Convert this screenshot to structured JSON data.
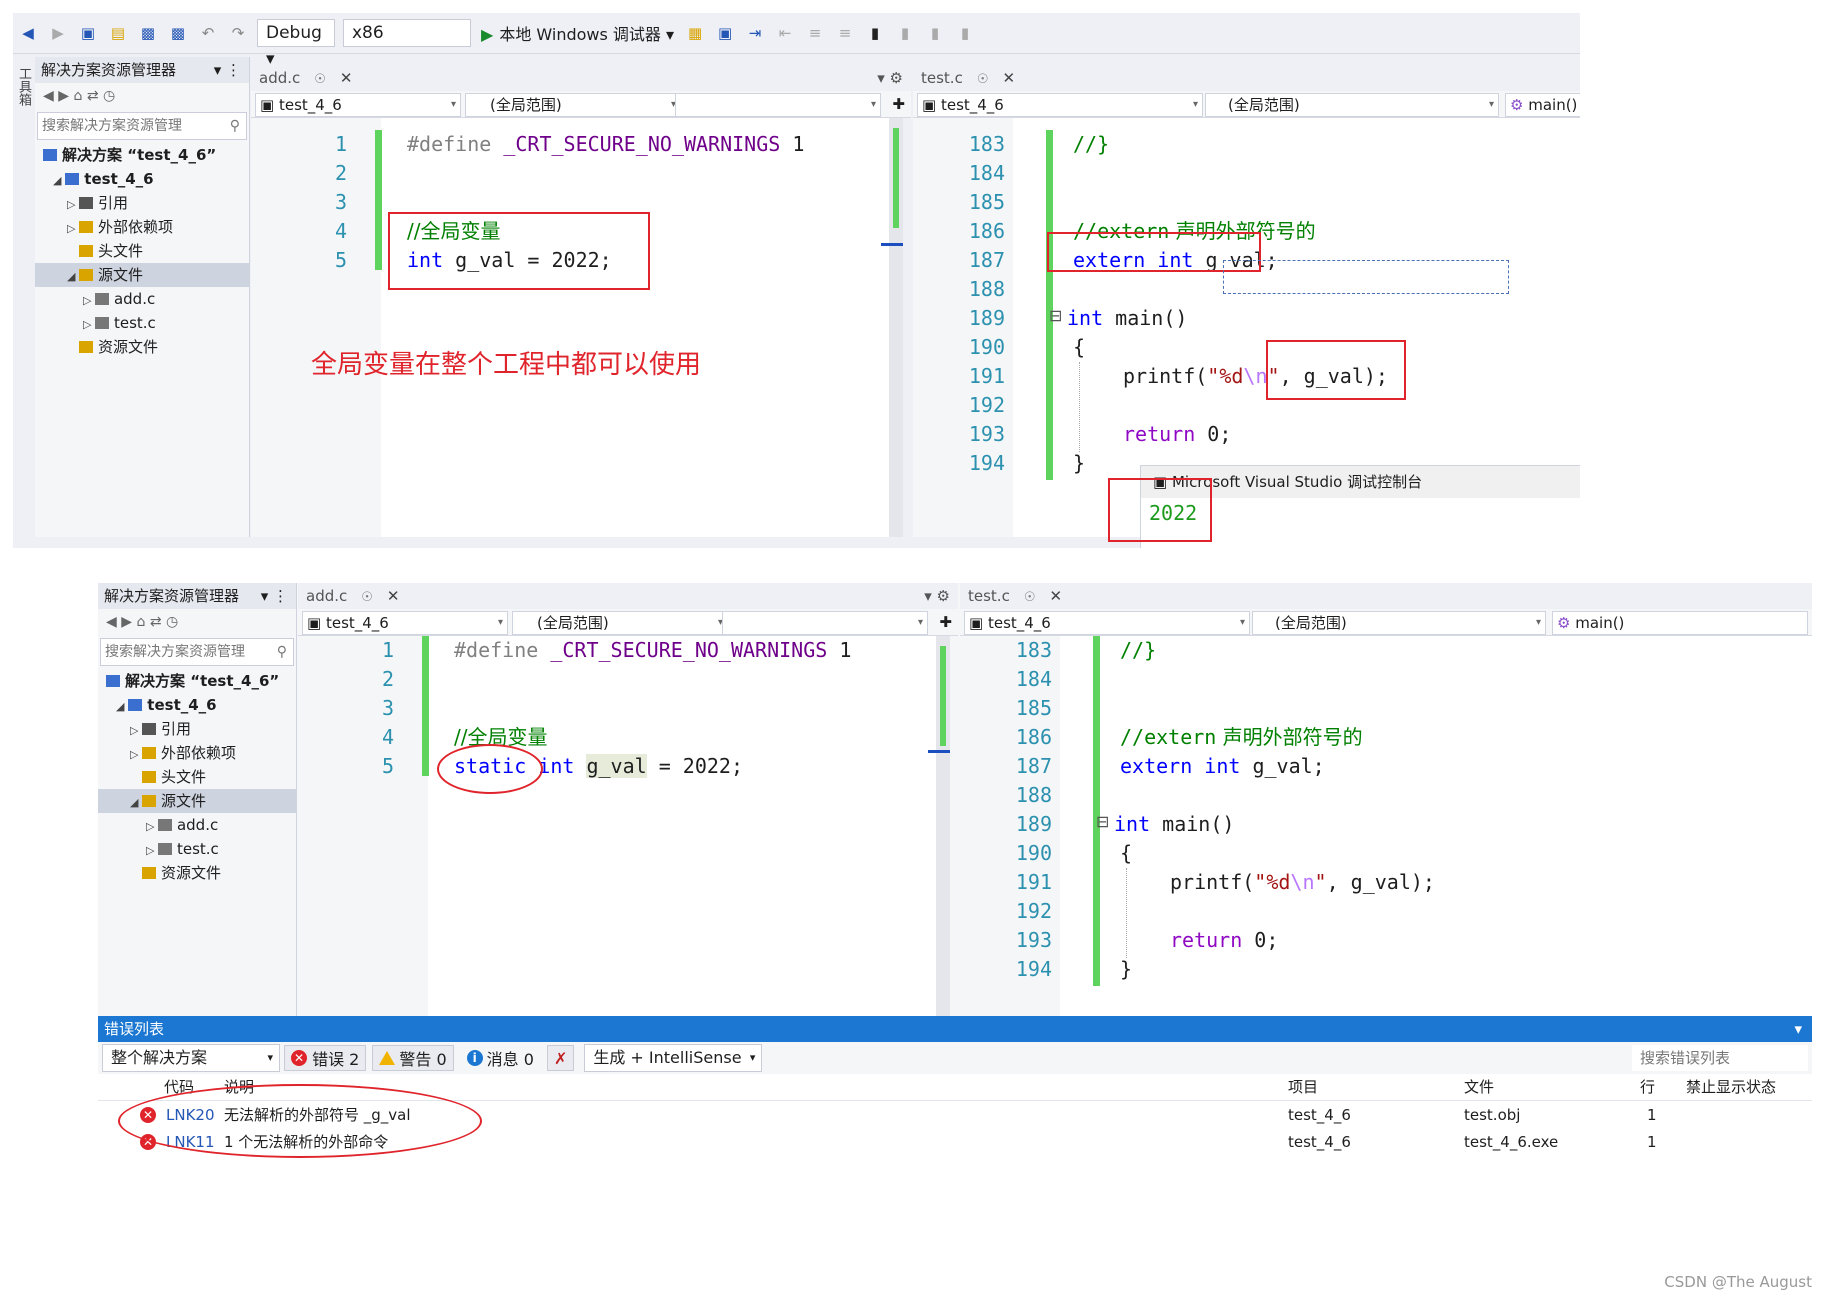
{
  "toolbar": {
    "config": "Debug",
    "platform": "x86",
    "run_label": "本地 Windows 调试器"
  },
  "solution_explorer": {
    "title": "解决方案资源管理器",
    "search_placeholder": "搜索解决方案资源管理",
    "items": [
      {
        "label": "解决方案 “test_4_6”"
      },
      {
        "label": "test_4_6"
      },
      {
        "label": "引用"
      },
      {
        "label": "外部依赖项"
      },
      {
        "label": "头文件"
      },
      {
        "label": "源文件"
      },
      {
        "label": "add.c"
      },
      {
        "label": "test.c"
      },
      {
        "label": "资源文件"
      }
    ]
  },
  "side_tab": "工具箱",
  "left_editor": {
    "tab": "add.c",
    "nav_project": "test_4_6",
    "nav_scope": "(全局范围)",
    "lines": [
      "1",
      "2",
      "3",
      "4",
      "5"
    ],
    "define_kw": "#define",
    "define_macro": "_CRT_SECURE_NO_WARNINGS",
    "define_value": "1",
    "comment": "//全局变量",
    "top_line5_int": "int",
    "top_line5_rest": " g_val = 2022;",
    "bottom_line5_static": "static",
    "bottom_line5_int": "int",
    "bottom_line5_var": "g_val",
    "bottom_line5_rest": " = 2022;"
  },
  "right_editor": {
    "tab": "test.c",
    "nav_project": "test_4_6",
    "nav_scope": "(全局范围)",
    "nav_func": "main()",
    "lines": [
      "183",
      "184",
      "185",
      "186",
      "187",
      "188",
      "189",
      "190",
      "191",
      "192",
      "193",
      "194"
    ],
    "l183": "//}",
    "l186_comment": "//extern",
    "l186_comment_cn": " 声明外部符号的",
    "l187_extern": "extern",
    "l187_int": "int",
    "l187_var": " g_val;",
    "l189_int": "int",
    "l189_main": " main()",
    "l190": "{",
    "l191_printf": "printf(",
    "l191_str1": "\"%d",
    "l191_esc": "\\n",
    "l191_str2": "\"",
    "l191_comma": ",",
    "l191_args": " g_val);",
    "l193_return": "return",
    "l193_rest": " 0;",
    "l194": "}"
  },
  "annotation": "全局变量在整个工程中都可以使用",
  "console": {
    "title": "Microsoft Visual Studio 调试控制台",
    "output": "2022"
  },
  "error_list": {
    "title": "错误列表",
    "scope": "整个解决方案",
    "errors_btn": "错误 2",
    "warnings_btn": "警告 0",
    "messages_btn": "消息 0",
    "build_filter": "生成 + IntelliSense",
    "search_placeholder": "搜索错误列表",
    "columns": [
      "代码",
      "说明",
      "项目",
      "文件",
      "行",
      "禁止显示状态"
    ],
    "rows": [
      {
        "code": "LNK20",
        "desc": "无法解析的外部符号 _g_val",
        "project": "test_4_6",
        "file": "test.obj",
        "line": "1"
      },
      {
        "code": "LNK11",
        "desc": "1 个无法解析的外部命令",
        "project": "test_4_6",
        "file": "test_4_6.exe",
        "line": "1"
      }
    ]
  },
  "watermark": "CSDN @The   August",
  "colors": {
    "annotation_red": "#e0242b",
    "keyword_blue": "#0000ff",
    "comment_green": "#008000",
    "change_bar_green": "#5ed35e",
    "error_header_blue": "#1b77d2"
  }
}
